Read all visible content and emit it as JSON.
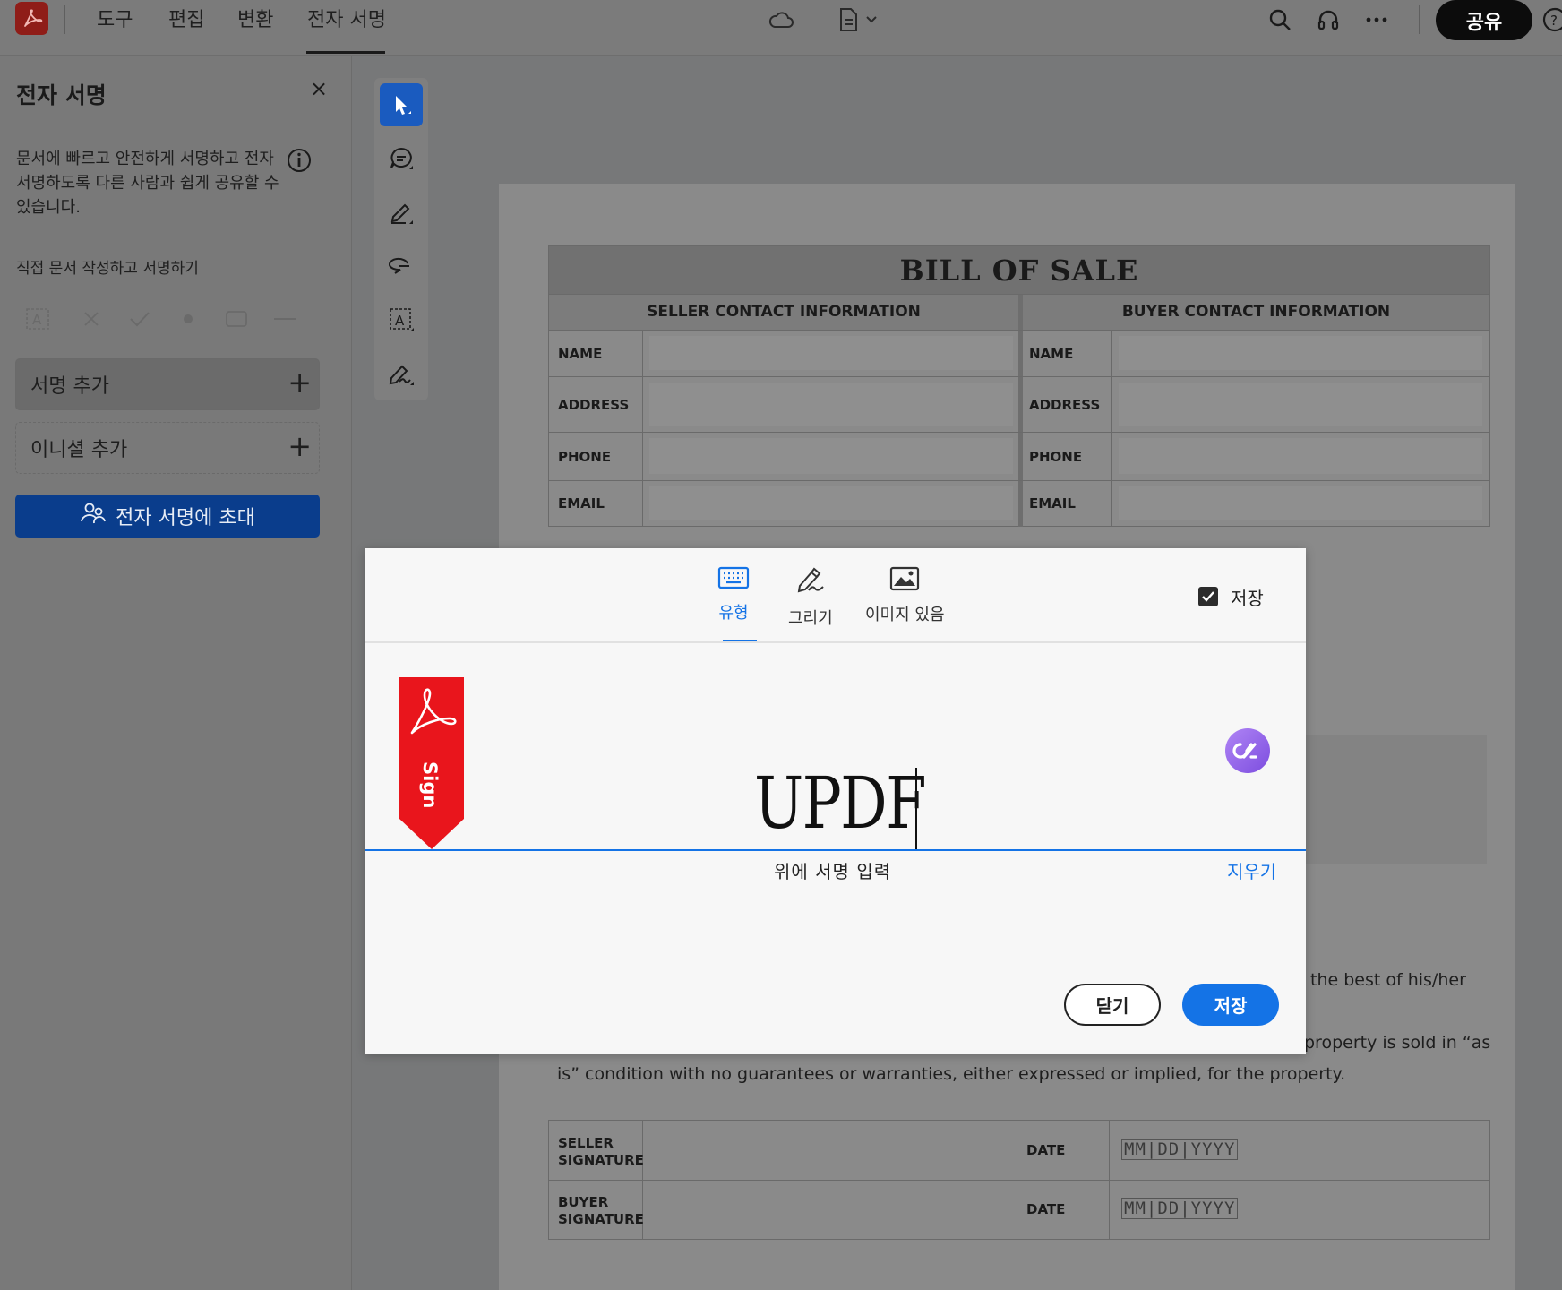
{
  "topbar": {
    "menu": [
      "도구",
      "편집",
      "변환",
      "전자 서명"
    ],
    "active_menu": "전자 서명",
    "share_label": "공유",
    "icons": [
      "acrobat-logo-icon",
      "cloud-icon",
      "document-icon",
      "chevron-down-icon",
      "search-icon",
      "headset-icon",
      "more-icon",
      "help-icon"
    ]
  },
  "left_panel": {
    "title": "전자 서명",
    "close_glyph": "×",
    "description": "문서에 빠르고 안전하게 서명하고 전자 서명하도록 다른 사람과 쉽게 공유할 수 있습니다.",
    "subtitle": "직접 문서 작성하고 서명하기",
    "tools": [
      "text-field-icon",
      "cross-mark-icon",
      "check-mark-icon",
      "dot-icon",
      "rectangle-icon",
      "line-icon"
    ],
    "add_signature": "서명 추가",
    "add_initials": "이니셜 추가",
    "plus_glyph": "+",
    "invite_label": "전자 서명에 초대"
  },
  "vertical_toolbar": {
    "tools": [
      "select-cursor-icon",
      "comment-icon",
      "highlight-pen-icon",
      "lasso-icon",
      "text-box-icon",
      "sign-pen-icon"
    ]
  },
  "document": {
    "title": "BILL OF SALE",
    "seller_header": "SELLER CONTACT INFORMATION",
    "buyer_header": "BUYER CONTACT INFORMATION",
    "rows": [
      "NAME",
      "ADDRESS",
      "PHONE",
      "EMAIL"
    ],
    "text_line_1": "the best of his/her",
    "text_line_2": "property is sold in “as",
    "text_line_3": "is” condition with no guarantees or warranties, either expressed or implied, for the property.",
    "seller_signature": "SELLER\nSIGNATURE",
    "buyer_signature": "BUYER\nSIGNATURE",
    "date_label": "DATE",
    "date_format": "MM|DD|YYYY"
  },
  "modal": {
    "tabs": [
      {
        "label": "유형",
        "icon": "keyboard-icon",
        "active": true
      },
      {
        "label": "그리기",
        "icon": "draw-pen-icon",
        "active": false
      },
      {
        "label": "이미지 있음",
        "icon": "image-icon",
        "active": false
      }
    ],
    "save_checkbox_label": "저장",
    "save_checked": true,
    "ribbon_text": "Sign",
    "signature_value": "UPDF",
    "hint": "위에 서명 입력",
    "clear_label": "지우기",
    "close_button": "닫기",
    "save_button": "저장",
    "accent_color": "#1473e6"
  }
}
